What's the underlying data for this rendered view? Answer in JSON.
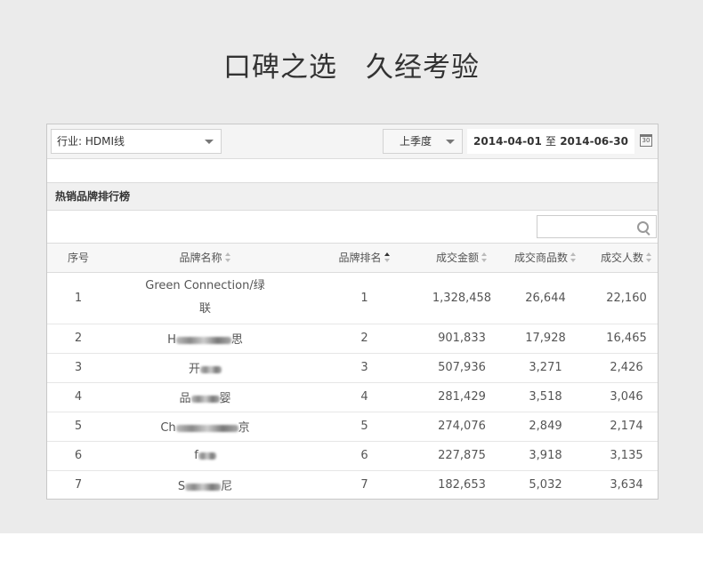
{
  "header": {
    "title": "口碑之选　久经考验"
  },
  "toolbar": {
    "industry_select": "行业: HDMI线",
    "period_select": "上季度",
    "date_start": "2014-04-01",
    "date_sep": "至",
    "date_end": "2014-06-30",
    "calendar_icon_label": "30"
  },
  "section": {
    "title": "热销品牌排行榜"
  },
  "search": {
    "value": "",
    "placeholder": ""
  },
  "table": {
    "columns": [
      "序号",
      "品牌名称",
      "品牌排名",
      "成交金额",
      "成交商品数",
      "成交人数"
    ],
    "rows": [
      {
        "index": "1",
        "brand_a": "Green Connection/绿",
        "brand_b": "联",
        "rank": "1",
        "amount": "1,328,458",
        "items": "26,644",
        "buyers": "22,160"
      },
      {
        "index": "2",
        "brand_a": "H",
        "brand_b": "思",
        "rank": "2",
        "amount": "901,833",
        "items": "17,928",
        "buyers": "16,465"
      },
      {
        "index": "3",
        "brand_a": "开",
        "brand_b": "",
        "rank": "3",
        "amount": "507,936",
        "items": "3,271",
        "buyers": "2,426"
      },
      {
        "index": "4",
        "brand_a": "品",
        "brand_b": "婴",
        "rank": "4",
        "amount": "281,429",
        "items": "3,518",
        "buyers": "3,046"
      },
      {
        "index": "5",
        "brand_a": "Ch",
        "brand_b": "京",
        "rank": "5",
        "amount": "274,076",
        "items": "2,849",
        "buyers": "2,174"
      },
      {
        "index": "6",
        "brand_a": "f",
        "brand_b": "",
        "rank": "6",
        "amount": "227,875",
        "items": "3,918",
        "buyers": "3,135"
      },
      {
        "index": "7",
        "brand_a": "S",
        "brand_b": "尼",
        "rank": "7",
        "amount": "182,653",
        "items": "5,032",
        "buyers": "3,634"
      }
    ]
  }
}
